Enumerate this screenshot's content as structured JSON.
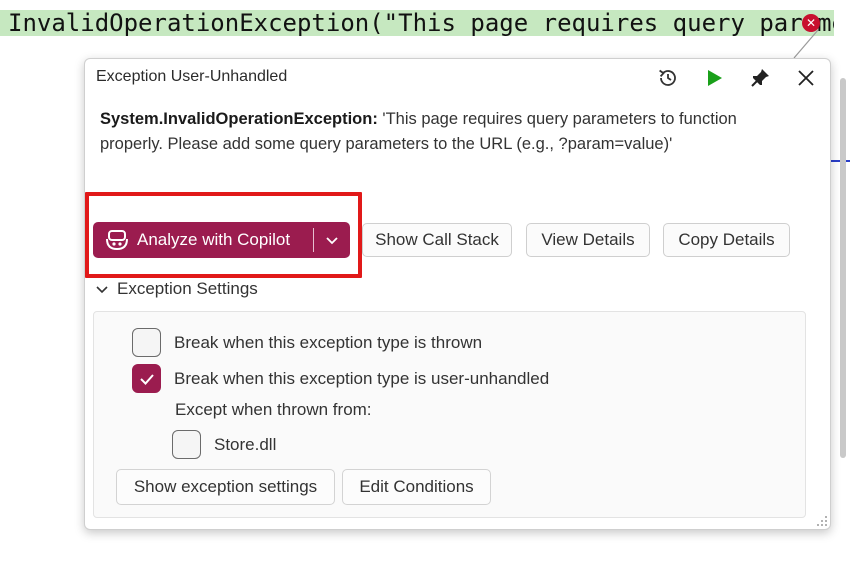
{
  "editor": {
    "code_line": "InvalidOperationException(\"This page requires query paramet"
  },
  "popup": {
    "title": "Exception User-Unhandled",
    "message_type": "System.InvalidOperationException:",
    "message_text": " 'This page requires query parameters to function properly. Please add some query parameters to the URL (e.g., ?param=value)'",
    "icons": [
      "history-icon",
      "continue-icon",
      "pin-icon",
      "close-icon"
    ],
    "colors": {
      "accent": "#9b1c4f",
      "highlight": "#e11919",
      "continue": "#1aa01a"
    }
  },
  "actions": {
    "copilot_label": "Analyze with Copilot",
    "call_stack_label": "Show Call Stack",
    "view_details_label": "View Details",
    "copy_details_label": "Copy Details"
  },
  "settings": {
    "header": "Exception Settings",
    "options": [
      {
        "label": "Break when this exception type is thrown",
        "checked": false
      },
      {
        "label": "Break when this exception type is user-unhandled",
        "checked": true
      }
    ],
    "except_label": "Except when thrown from:",
    "modules": [
      {
        "label": "Store.dll",
        "checked": false
      }
    ],
    "show_settings_label": "Show exception settings",
    "edit_conditions_label": "Edit Conditions"
  }
}
